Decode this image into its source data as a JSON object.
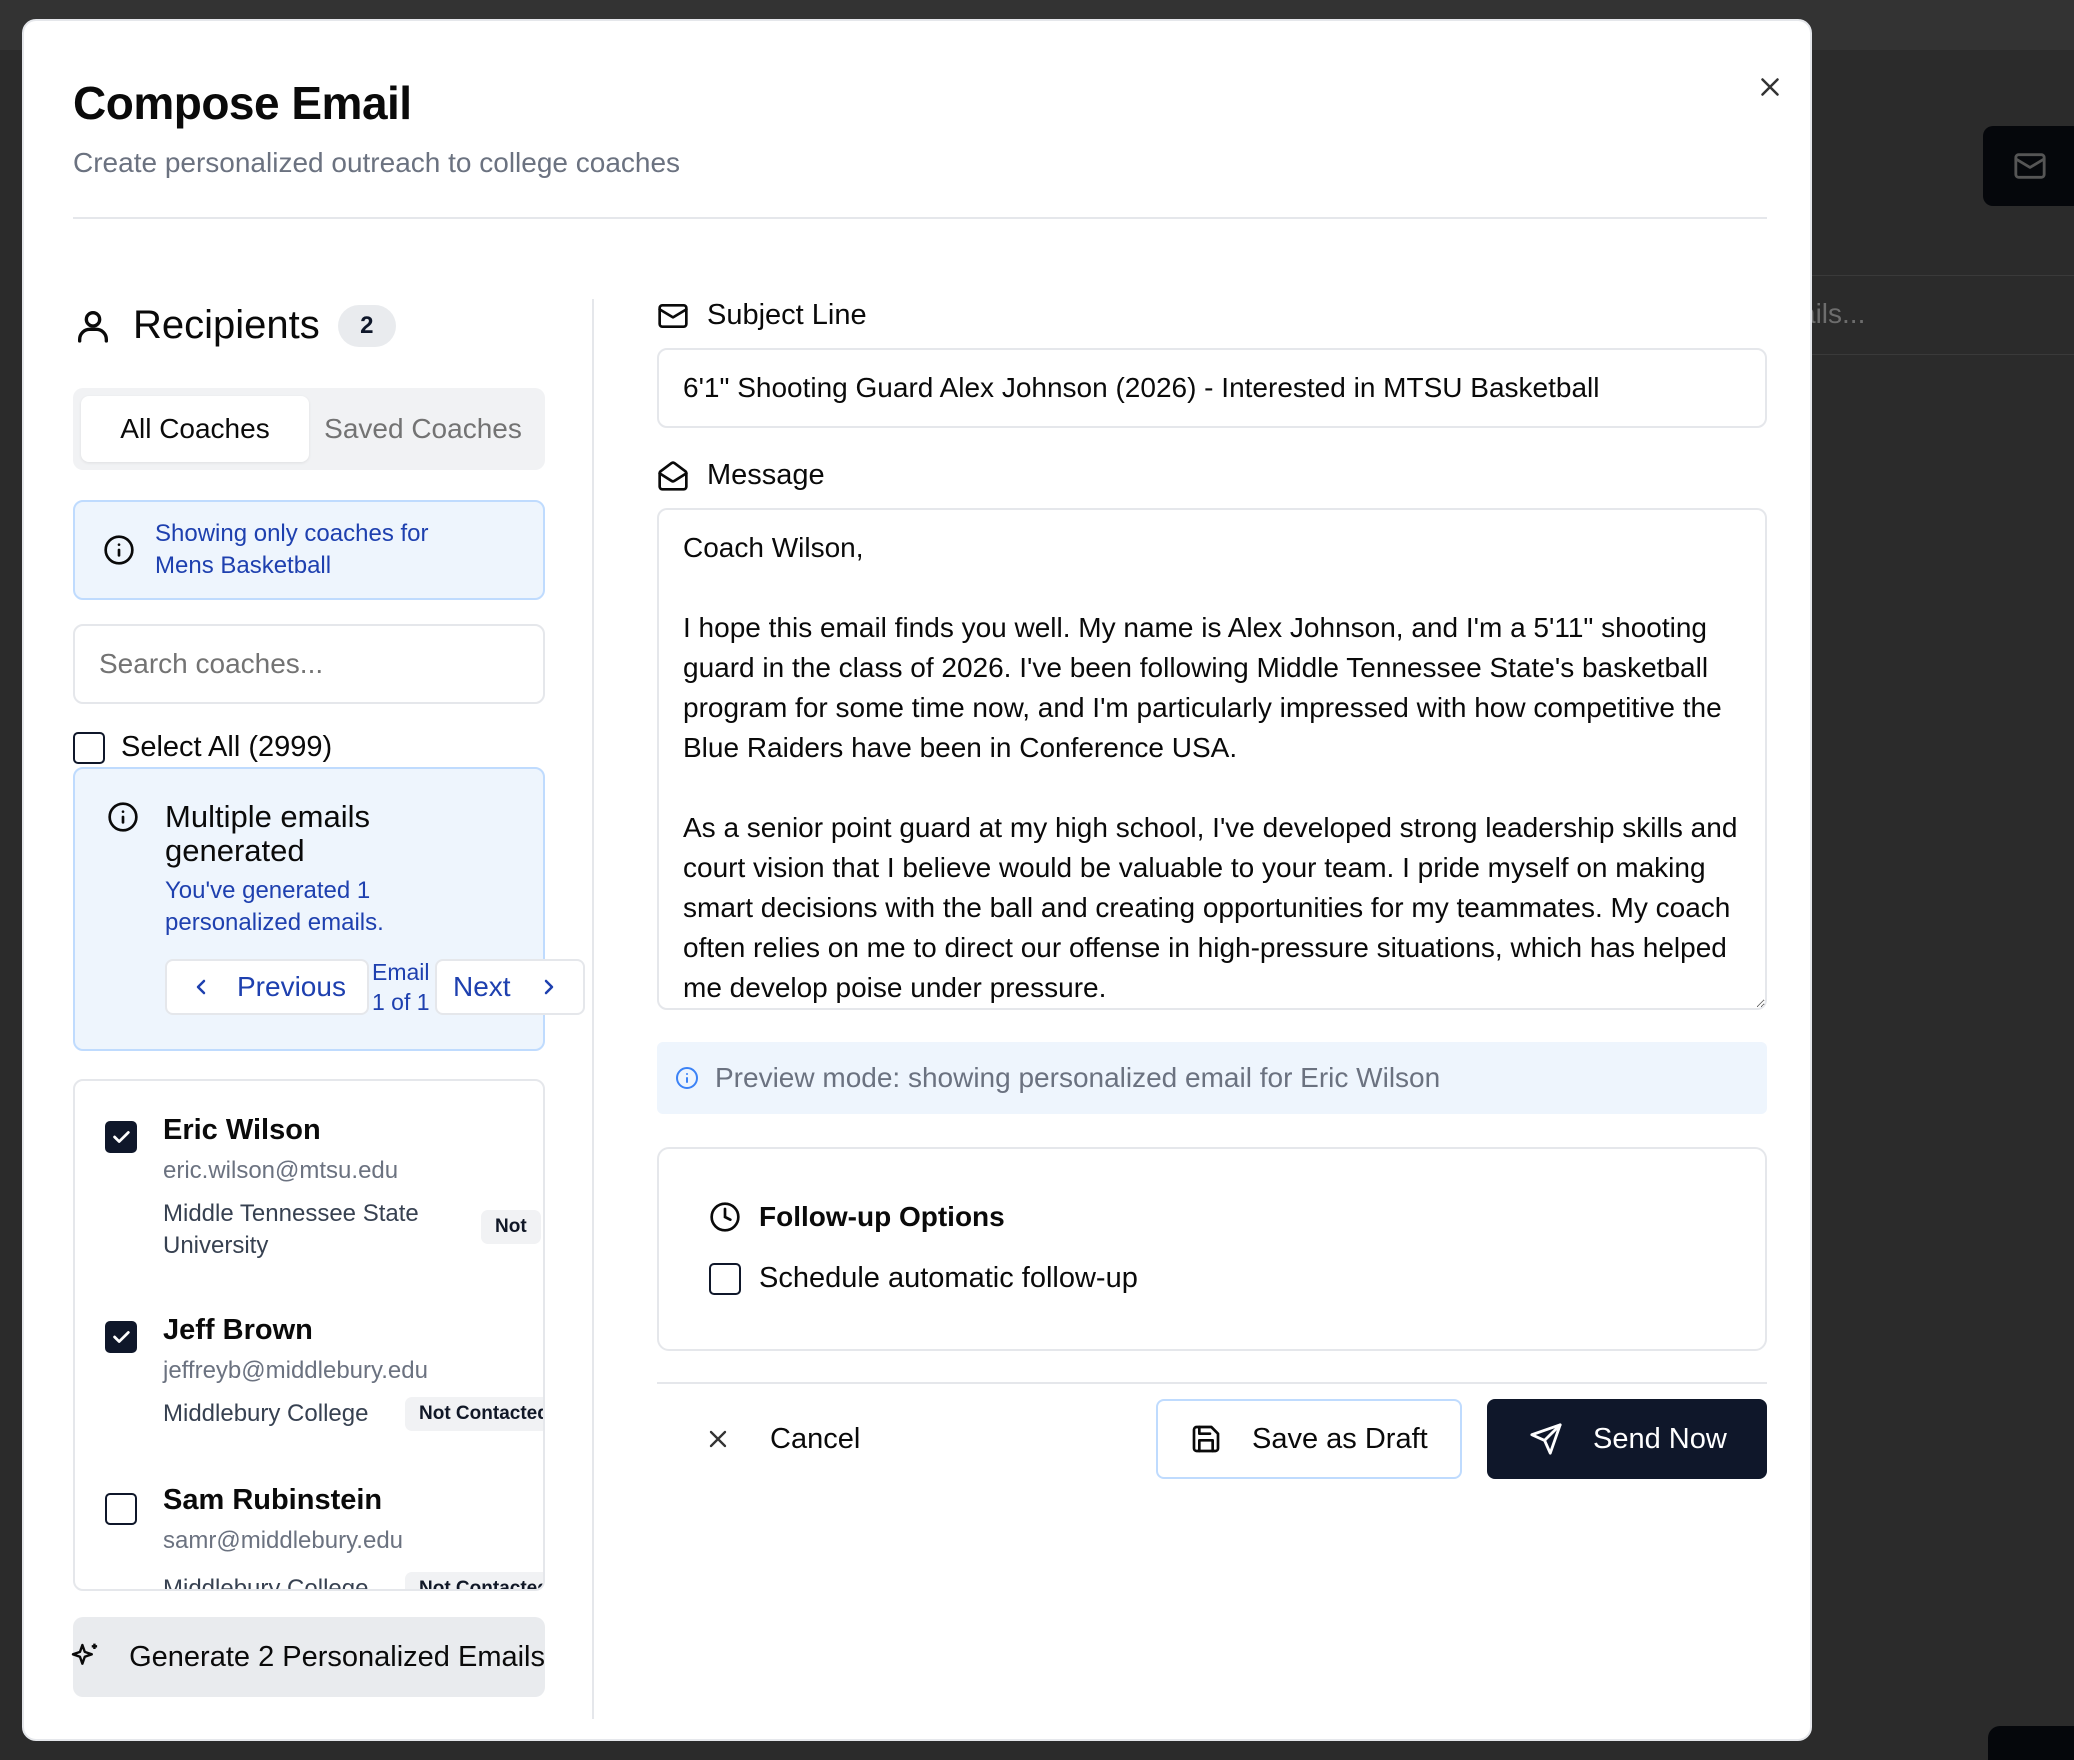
{
  "background": {
    "search_hint": "ails..."
  },
  "modal": {
    "title": "Compose Email",
    "subtitle": "Create personalized outreach to college coaches"
  },
  "recipients": {
    "label": "Recipients",
    "count": "2",
    "tabs": [
      {
        "label": "All Coaches",
        "active": true
      },
      {
        "label": "Saved Coaches",
        "active": false
      }
    ],
    "filter_note": "Showing only coaches for Mens Basketball",
    "search_placeholder": "Search coaches...",
    "select_all_label": "Select All (2999)",
    "multi": {
      "title": "Multiple emails generated",
      "description": "You've generated 1 personalized emails.",
      "prev_label": "Previous",
      "next_label": "Next",
      "counter": "Email 1 of 1"
    },
    "coaches": [
      {
        "name": "Eric Wilson",
        "email": "eric.wilson@mtsu.edu",
        "school": "Middle Tennessee State University",
        "status": "Not",
        "checked": true
      },
      {
        "name": "Jeff Brown",
        "email": "jeffreyb@middlebury.edu",
        "school": "Middlebury College",
        "status": "Not Contacted",
        "checked": true
      },
      {
        "name": "Sam Rubinstein",
        "email": "samr@middlebury.edu",
        "school": "Middlebury College",
        "status": "Not Contacted",
        "checked": false
      }
    ],
    "generate_label": "Generate 2 Personalized Emails"
  },
  "compose": {
    "subject_label": "Subject Line",
    "subject_value": "6'1\" Shooting Guard Alex Johnson (2026) - Interested in MTSU Basketball",
    "message_label": "Message",
    "message_value": "Coach Wilson,\n\nI hope this email finds you well. My name is Alex Johnson, and I'm a 5'11\" shooting guard in the class of 2026. I've been following Middle Tennessee State's basketball program for some time now, and I'm particularly impressed with how competitive the Blue Raiders have been in Conference USA.\n\nAs a senior point guard at my high school, I've developed strong leadership skills and court vision that I believe would be valuable to your team. I pride myself on making smart decisions with the ball and creating opportunities for my teammates. My coach often relies on me to direct our offense in high-pressure situations, which has helped me develop poise under pressure.",
    "preview_note": "Preview mode: showing personalized email for Eric Wilson",
    "followup_title": "Follow-up Options",
    "followup_option": "Schedule automatic follow-up",
    "cancel_label": "Cancel",
    "draft_label": "Save as Draft",
    "send_label": "Send Now"
  },
  "colors": {
    "primary": "#0f172a",
    "info_bg": "#eef5fd",
    "info_text": "#1e40af",
    "border": "#e5e7eb"
  }
}
